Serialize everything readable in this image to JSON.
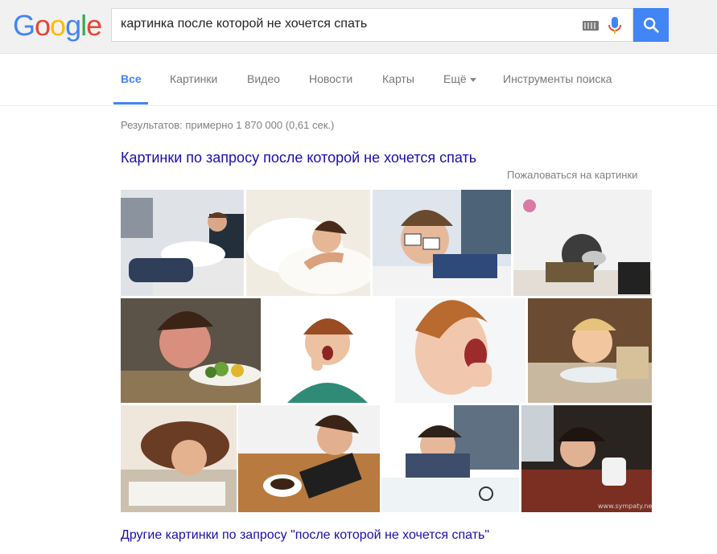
{
  "search": {
    "query": "картинка после которой не хочется спать"
  },
  "logo": {
    "letters": [
      "G",
      "o",
      "o",
      "g",
      "l",
      "e"
    ],
    "colors": [
      "#4285f4",
      "#ea4335",
      "#fbbc05",
      "#4285f4",
      "#34a853",
      "#ea4335"
    ]
  },
  "nav": {
    "tabs": [
      {
        "label": "Все",
        "active": true
      },
      {
        "label": "Картинки"
      },
      {
        "label": "Видео"
      },
      {
        "label": "Новости"
      },
      {
        "label": "Карты"
      },
      {
        "label": "Ещё"
      },
      {
        "label": "Инструменты поиска"
      }
    ]
  },
  "results": {
    "count": "Результатов: примерно 1 870 000 (0,61 сек.)",
    "images_heading": "Картинки по запросу после которой не хочется спать",
    "report": "Пожаловаться на картинки",
    "more_images": "Другие картинки по запросу \"после которой не хочется спать\"",
    "watermark": "www.sympaty.net"
  },
  "colors": {
    "accent": "#4285f4",
    "link": "#1a0dab",
    "muted": "#808080"
  }
}
